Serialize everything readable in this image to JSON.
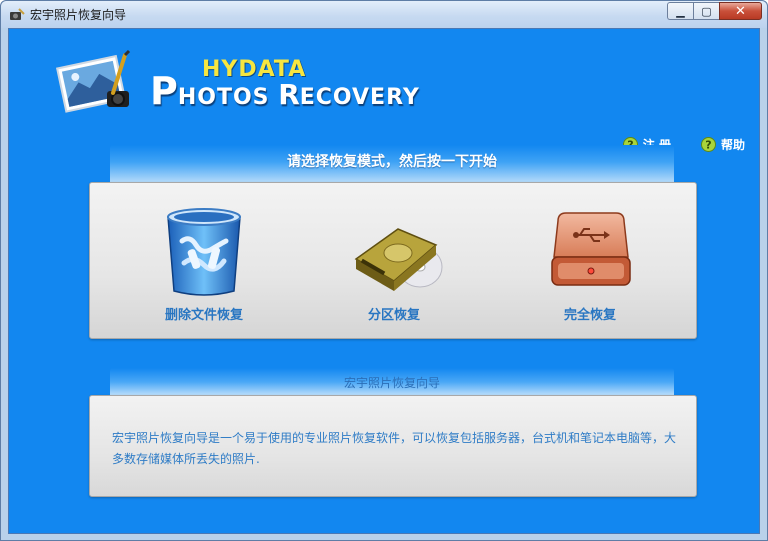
{
  "window": {
    "title": "宏宇照片恢复向导",
    "controls": {
      "minimize": "▁",
      "maximize": "▢",
      "close": "✕"
    }
  },
  "logo": {
    "line1": "HYDATA",
    "line2_p": "P",
    "line2_rest": "HOTOS ",
    "line2_r": "R",
    "line2_rest2": "ECOVERY"
  },
  "top_links": {
    "register": {
      "label": "注 册",
      "icon": "question-icon"
    },
    "help": {
      "label": "帮助",
      "icon": "question-icon"
    }
  },
  "mode_section": {
    "heading": "请选择恢复模式，然后按一下开始",
    "modes": [
      {
        "label": "删除文件恢复",
        "icon": "recycle-bin-icon"
      },
      {
        "label": "分区恢复",
        "icon": "hard-disk-icon"
      },
      {
        "label": "完全恢复",
        "icon": "usb-drive-icon"
      }
    ]
  },
  "info_section": {
    "heading": "宏宇照片恢复向导",
    "description": "宏宇照片恢复向导是一个易于使用的专业照片恢复软件，可以恢复包括服务器，台式机和笔记本电脑等，大多数存储媒体所丢失的照片."
  },
  "colors": {
    "client_bg": "#1287f0",
    "accent_text": "#2976c2",
    "logo_yellow": "#f7e640"
  }
}
